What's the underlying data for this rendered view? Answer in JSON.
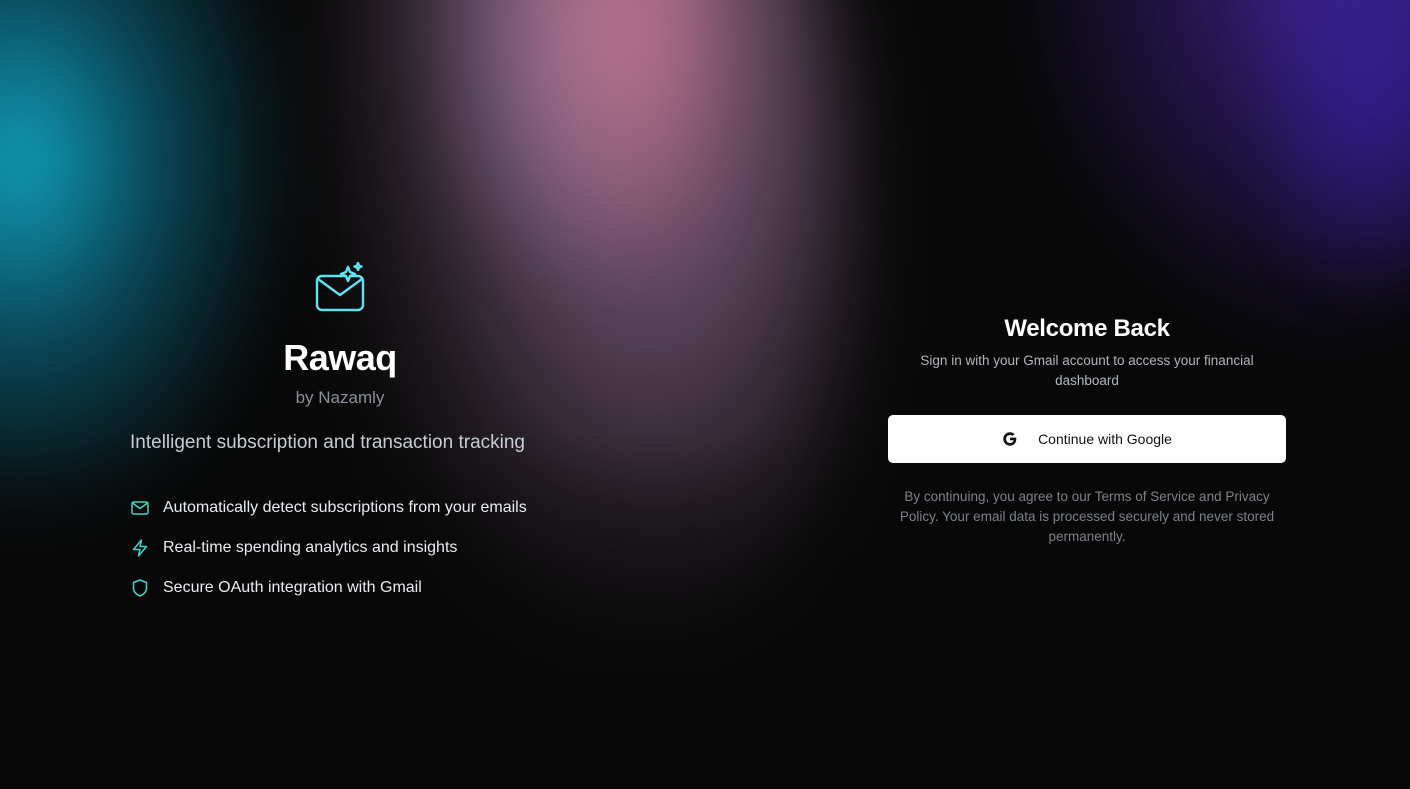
{
  "brand": {
    "name": "Rawaq",
    "subtitle": "by Nazamly",
    "tagline": "Intelligent subscription and transaction tracking",
    "logo_icon": "mail-sparkle-icon",
    "accent_color": "#5fe3f0"
  },
  "features": [
    {
      "icon": "mail-icon",
      "label": "Automatically detect subscriptions from your emails"
    },
    {
      "icon": "lightning-icon",
      "label": "Real-time spending analytics and insights"
    },
    {
      "icon": "shield-icon",
      "label": "Secure OAuth integration with Gmail"
    }
  ],
  "login": {
    "title": "Welcome Back",
    "description": "Sign in with your Gmail account to access your financial dashboard",
    "google_button_label": "Continue with Google",
    "google_icon": "google-icon",
    "terms": "By continuing, you agree to our Terms of Service and Privacy Policy. Your email data is processed securely and never stored permanently."
  },
  "colors": {
    "background": "#080808",
    "feature_icon": "#3ed6c8",
    "button_bg": "#ffffff"
  }
}
